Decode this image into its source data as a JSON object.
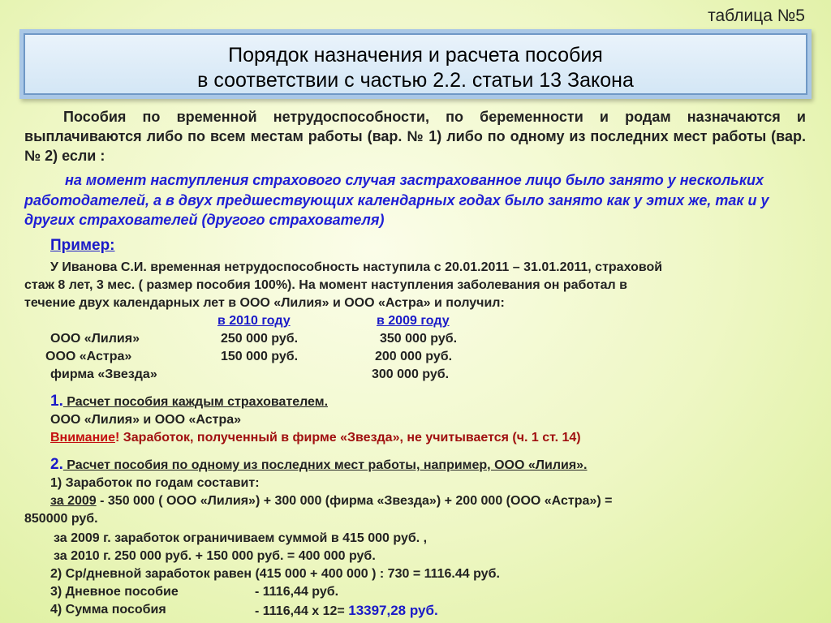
{
  "table_no": "таблица №5",
  "title": {
    "line1": "Порядок  назначения  и  расчета  пособия",
    "line2": "в соответствии с частью 2.2. статьи 13 Закона"
  },
  "intro": "Пособия по временной нетрудоспособности, по беременности и родам назначаются  и выплачиваются либо по всем местам работы    (вар. № 1)  либо по одному из последних мест работы (вар. № 2)  если :",
  "condition": "на момент наступления  страхового случая застрахованное лицо было занято у нескольких работодателей, а в двух предшествующих календарных годах было занято как у этих же, так и у других страхователей (другого страхователя)",
  "example": {
    "heading": "Пример:",
    "lines": [
      "У Иванова С.И. временная нетрудоспособность наступила  с 20.01.2011 – 31.01.2011, страховой",
      "стаж 8 лет, 3 мес. ( размер пособия 100%). На момент наступления  заболевания  он работал  в",
      "течение двух календарных лет в ООО «Лилия» и ООО «Астра»  и получил:"
    ],
    "col_2010": "в  2010 году",
    "col_2009": "в 2009  году",
    "rows": [
      {
        "name": "ООО «Лилия»",
        "y2010": "250 000 руб.",
        "y2009": "350 000 руб."
      },
      {
        "name": "ООО «Астра»",
        "y2010": "150 000 руб.",
        "y2009": "200 000 руб."
      },
      {
        "name": "фирма «Звезда»",
        "y2010": "",
        "y2009": "300 000 руб."
      }
    ]
  },
  "step1": {
    "num": "1.",
    "heading": " Расчет пособия  каждым страхователем.",
    "line": "ООО «Лилия»  и  ООО «Астра»",
    "attention": "Внимание",
    "excl": "!",
    "attention_text": " Заработок, полученный в фирме «Звезда», не учитывается (ч. 1 ст. 14)"
  },
  "step2": {
    "num": "2.",
    "heading": " Расчет пособия по одному из  последних мест работы, например, ООО «Лилия».",
    "l1": "1) Заработок по годам составит:",
    "l2_u": "за 2009",
    "l2": "  - 350 000 ( ООО «Лилия») + 300 000 (фирма «Звезда»)  + 200 000  (ООО «Астра»)  =",
    "l3": "850000 руб.",
    "l4": "за 2009 г.    заработок ограничиваем суммой в  415 000 руб. ,",
    "l5": "за 2010 г.    250 000 руб. + 150 000 руб. = 400 000 руб.",
    "l6": "2) Ср/дневной заработок равен (415 000 + 400 000 ) : 730 = 1116.44 руб.",
    "l7a": "3) Дневное пособие",
    "l7b": "- 1116,44 руб.",
    "l8a": "4) Сумма    пособия",
    "l8b": "- 1116,44  х 12=",
    "l8c": "13397,28 руб."
  }
}
